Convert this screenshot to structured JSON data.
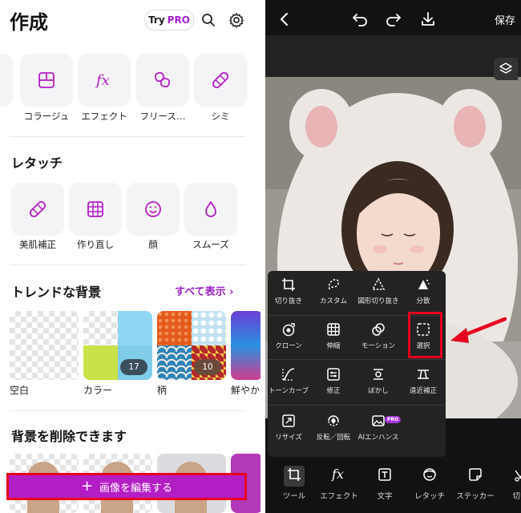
{
  "left": {
    "title": "作成",
    "try_pro": {
      "try": "Try",
      "pro": "PRO"
    },
    "tools": [
      {
        "label": "コラージュ",
        "icon": "collage-icon"
      },
      {
        "label": "エフェクト",
        "icon": "fx-icon"
      },
      {
        "label": "フリース…",
        "icon": "freestyle-icon"
      },
      {
        "label": "シミ",
        "icon": "bandage-icon"
      }
    ],
    "retouch": {
      "title": "レタッチ",
      "items": [
        {
          "label": "美肌補正",
          "icon": "bandage-icon"
        },
        {
          "label": "作り直し",
          "icon": "grid-icon"
        },
        {
          "label": "顔",
          "icon": "smile-icon"
        },
        {
          "label": "スムーズ",
          "icon": "drop-icon"
        }
      ]
    },
    "trend": {
      "title": "トレンドな背景",
      "see_all": "すべて表示",
      "cards": [
        {
          "label": "空白"
        },
        {
          "label": "カラー",
          "count": "17"
        },
        {
          "label": "柄",
          "count": "10"
        },
        {
          "label": "鮮やか"
        }
      ]
    },
    "remove_bg": {
      "title": "背景を削除できます"
    },
    "edit_button": "画像を編集する",
    "colors": {
      "accent": "#b31ec4",
      "link": "#9b22c7"
    }
  },
  "right": {
    "save": "保存",
    "tools": [
      {
        "label": "切り抜き",
        "icon": "crop-icon"
      },
      {
        "label": "カスタム",
        "icon": "custom-lasso-icon"
      },
      {
        "label": "図形切り抜き",
        "icon": "triangle-icon"
      },
      {
        "label": "分散",
        "icon": "disperse-icon"
      },
      {
        "label": "クローン",
        "icon": "clone-icon"
      },
      {
        "label": "伸縮",
        "icon": "stretch-icon"
      },
      {
        "label": "モーション",
        "icon": "motion-icon"
      },
      {
        "label": "選択",
        "icon": "select-icon"
      },
      {
        "label": "トーンカーブ",
        "icon": "tone-curve-icon"
      },
      {
        "label": "修正",
        "icon": "adjust-icon"
      },
      {
        "label": "ぼかし",
        "icon": "blur-icon"
      },
      {
        "label": "遠近補正",
        "icon": "perspective-icon"
      },
      {
        "label": "リサイズ",
        "icon": "resize-icon"
      },
      {
        "label": "反転／回転",
        "icon": "flip-rotate-icon"
      },
      {
        "label": "AIエンハンス",
        "icon": "ai-enhance-icon",
        "badge": "PRO"
      }
    ],
    "nav": [
      {
        "label": "ツール",
        "icon": "crop-icon"
      },
      {
        "label": "エフェクト",
        "icon": "fx-icon"
      },
      {
        "label": "文字",
        "icon": "text-icon"
      },
      {
        "label": "レタッチ",
        "icon": "retouch-icon"
      },
      {
        "label": "ステッカー",
        "icon": "sticker-icon"
      },
      {
        "label": "切り",
        "icon": "cut-icon"
      }
    ]
  }
}
